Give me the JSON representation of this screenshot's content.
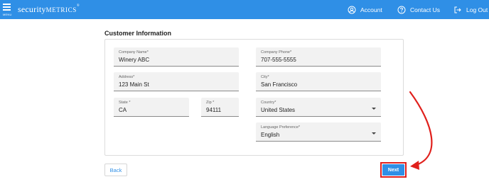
{
  "header": {
    "menu_label": "MENU",
    "logo_prefix": "security",
    "logo_suffix": "METRICS",
    "logo_mark": "®",
    "nav": [
      {
        "label": "Account",
        "icon": "account-circle-icon"
      },
      {
        "label": "Contact Us",
        "icon": "help-circle-icon"
      },
      {
        "label": "Log Out",
        "icon": "logout-icon"
      }
    ]
  },
  "section_title": "Customer Information",
  "form": {
    "company_name": {
      "label": "Company Name*",
      "value": "Winery ABC"
    },
    "company_phone": {
      "label": "Company Phone*",
      "value": "707-555-5555"
    },
    "address": {
      "label": "Address*",
      "value": "123 Main St"
    },
    "city": {
      "label": "City*",
      "value": "San Francisco"
    },
    "state": {
      "label": "State *",
      "value": "CA"
    },
    "zip": {
      "label": "Zip *",
      "value": "94111"
    },
    "country": {
      "label": "Country*",
      "value": "United States"
    },
    "language": {
      "label": "Language Preference*",
      "value": "English"
    }
  },
  "buttons": {
    "back": "Back",
    "next": "Next"
  },
  "colors": {
    "header_bg": "#2f8fe6",
    "primary": "#2f8fe6",
    "highlight": "#e0201c"
  }
}
